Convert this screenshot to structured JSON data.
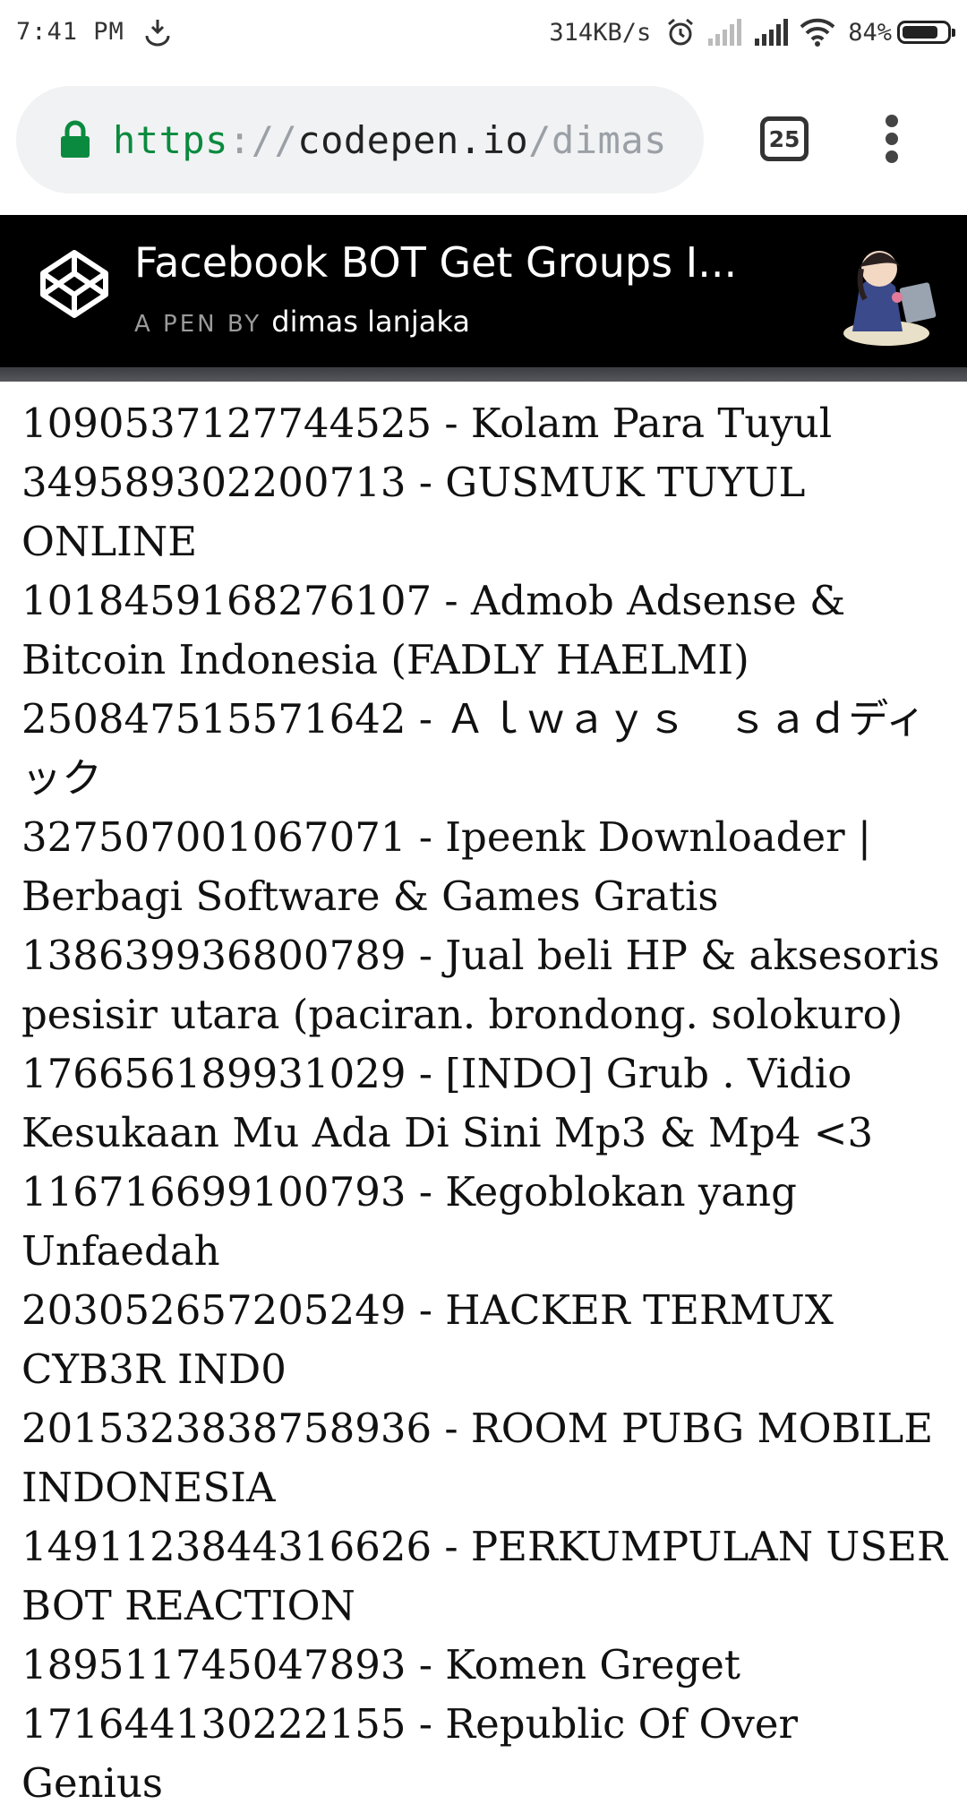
{
  "status_bar": {
    "time": "7:41 PM",
    "net_speed": "314KB/s",
    "battery_text": "84%",
    "battery_level": 0.84
  },
  "browser": {
    "url_scheme": "https",
    "url_sep": "://",
    "url_host": "codepen.io",
    "url_path": "/dimas",
    "tab_count": "25"
  },
  "pen": {
    "title": "Facebook BOT Get Groups I...",
    "by_label": "A PEN BY",
    "author": "dimas lanjaka"
  },
  "groups": [
    "1090537127744525 - Kolam Para Tuyul",
    "349589302200713 - GUSMUK TUYUL ONLINE",
    "1018459168276107 - Admob Adsense & Bitcoin Indonesia (FADLY HAELMI)",
    "250847515571642 - Ａｌｗａｙｓ　ｓａｄディック",
    "327507001067071 - Ipeenk Downloader | Berbagi Software & Games Gratis",
    "138639936800789 - Jual beli HP & aksesoris pesisir utara (paciran. brondong. solokuro)",
    "176656189931029 - [INDO] Grub . Vidio Kesukaan Mu Ada Di Sini Mp3 & Mp4 <3",
    "116716699100793 - Kegoblokan yang Unfaedah",
    "203052657205249 - HACKER TERMUX CYB3R IND0",
    "2015323838758936 - ROOM PUBG MOBILE INDONESIA",
    "1491123844316626 - PERKUMPULAN USER BOT REACTION",
    "189511745047893 - Komen Greget",
    "171644130222155 - Republic Of Over Genius"
  ]
}
